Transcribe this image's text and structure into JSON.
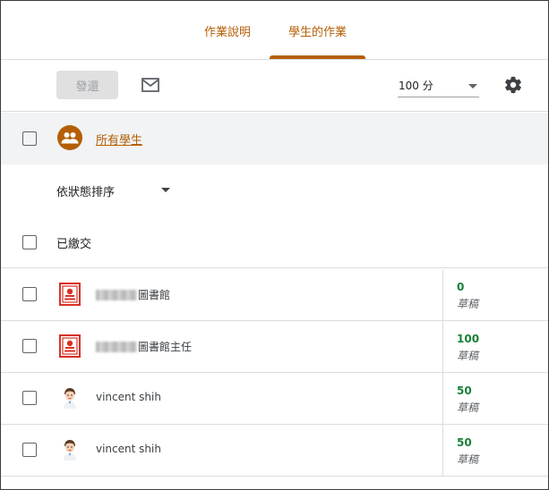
{
  "tabs": [
    {
      "label": "作業說明",
      "active": false
    },
    {
      "label": "學生的作業",
      "active": true
    }
  ],
  "toolbar": {
    "return_label": "發還",
    "mail_icon": "mail-icon",
    "points_value": "100 分",
    "settings_icon": "gear-icon"
  },
  "all_students": {
    "label": "所有學生",
    "icon": "people-icon"
  },
  "sort": {
    "label": "依狀態排序"
  },
  "section": {
    "label": "已繳交"
  },
  "students": [
    {
      "name_suffix": "圖書館",
      "avatar": "library-badge-icon",
      "grade": "0",
      "status": "草稿"
    },
    {
      "name_suffix": "圖書館主任",
      "avatar": "library-badge-icon",
      "grade": "100",
      "status": "草稿"
    },
    {
      "name": "vincent shih",
      "avatar": "cartoon-person-avatar",
      "grade": "50",
      "status": "草稿"
    },
    {
      "name": "vincent shih",
      "avatar": "cartoon-person-avatar",
      "grade": "50",
      "status": "草稿"
    }
  ],
  "colors": {
    "accent": "#b45f06",
    "grade": "#188038",
    "divider": "#dadce0",
    "badge": "#d93025"
  }
}
